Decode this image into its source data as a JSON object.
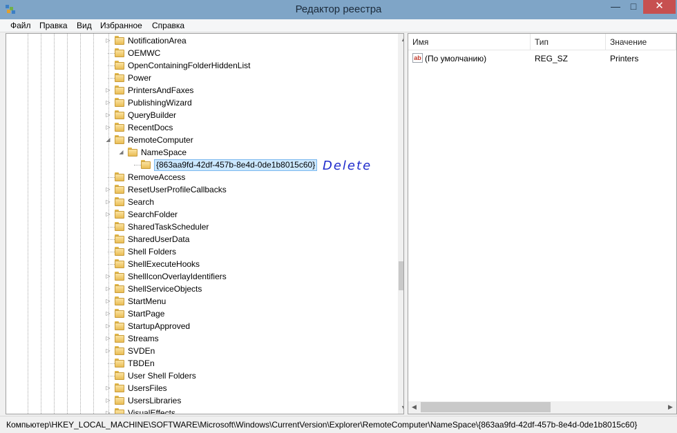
{
  "window": {
    "title": "Редактор реестра",
    "minimize_glyph": "—",
    "maximize_glyph": "□",
    "close_glyph": "✕"
  },
  "menu": [
    "Файл",
    "Правка",
    "Вид",
    "Избранное",
    "Справка"
  ],
  "tree": {
    "items": [
      {
        "label": "NotificationArea",
        "level": 0,
        "expander": "collapsed"
      },
      {
        "label": "OEMWC",
        "level": 0,
        "expander": "none"
      },
      {
        "label": "OpenContainingFolderHiddenList",
        "level": 0,
        "expander": "none"
      },
      {
        "label": "Power",
        "level": 0,
        "expander": "none"
      },
      {
        "label": "PrintersAndFaxes",
        "level": 0,
        "expander": "collapsed"
      },
      {
        "label": "PublishingWizard",
        "level": 0,
        "expander": "collapsed"
      },
      {
        "label": "QueryBuilder",
        "level": 0,
        "expander": "collapsed"
      },
      {
        "label": "RecentDocs",
        "level": 0,
        "expander": "collapsed"
      },
      {
        "label": "RemoteComputer",
        "level": 0,
        "expander": "expanded"
      },
      {
        "label": "NameSpace",
        "level": 1,
        "expander": "expanded"
      },
      {
        "label": "{863aa9fd-42df-457b-8e4d-0de1b8015c60}",
        "level": 2,
        "expander": "none",
        "selected": true
      },
      {
        "label": "RemoveAccess",
        "level": 0,
        "expander": "none"
      },
      {
        "label": "ResetUserProfileCallbacks",
        "level": 0,
        "expander": "collapsed"
      },
      {
        "label": "Search",
        "level": 0,
        "expander": "collapsed"
      },
      {
        "label": "SearchFolder",
        "level": 0,
        "expander": "collapsed"
      },
      {
        "label": "SharedTaskScheduler",
        "level": 0,
        "expander": "none"
      },
      {
        "label": "SharedUserData",
        "level": 0,
        "expander": "none"
      },
      {
        "label": "Shell Folders",
        "level": 0,
        "expander": "none"
      },
      {
        "label": "ShellExecuteHooks",
        "level": 0,
        "expander": "none"
      },
      {
        "label": "ShellIconOverlayIdentifiers",
        "level": 0,
        "expander": "collapsed"
      },
      {
        "label": "ShellServiceObjects",
        "level": 0,
        "expander": "collapsed"
      },
      {
        "label": "StartMenu",
        "level": 0,
        "expander": "collapsed"
      },
      {
        "label": "StartPage",
        "level": 0,
        "expander": "collapsed"
      },
      {
        "label": "StartupApproved",
        "level": 0,
        "expander": "collapsed"
      },
      {
        "label": "Streams",
        "level": 0,
        "expander": "collapsed"
      },
      {
        "label": "SVDEn",
        "level": 0,
        "expander": "collapsed"
      },
      {
        "label": "TBDEn",
        "level": 0,
        "expander": "none"
      },
      {
        "label": "User Shell Folders",
        "level": 0,
        "expander": "none"
      },
      {
        "label": "UsersFiles",
        "level": 0,
        "expander": "collapsed"
      },
      {
        "label": "UsersLibraries",
        "level": 0,
        "expander": "collapsed"
      },
      {
        "label": "VisualEffects",
        "level": 0,
        "expander": "collapsed"
      }
    ],
    "annotation": "Delete",
    "scroll_up_glyph": "▲",
    "scroll_down_glyph": "▼"
  },
  "values": {
    "columns": [
      "Имя",
      "Тип",
      "Значение"
    ],
    "rows": [
      {
        "icon": "string-value-icon",
        "icon_text": "ab",
        "name": "(По умолчанию)",
        "type": "REG_SZ",
        "value": "Printers"
      }
    ],
    "scroll_left_glyph": "◀",
    "scroll_right_glyph": "▶"
  },
  "status": {
    "path": "Компьютер\\HKEY_LOCAL_MACHINE\\SOFTWARE\\Microsoft\\Windows\\CurrentVersion\\Explorer\\RemoteComputer\\NameSpace\\{863aa9fd-42df-457b-8e4d-0de1b8015c60}"
  },
  "colors": {
    "titlebar": "#7fa5c7",
    "close": "#c75050",
    "selection": "#cce8ff",
    "annotation": "#1f2bcc"
  }
}
